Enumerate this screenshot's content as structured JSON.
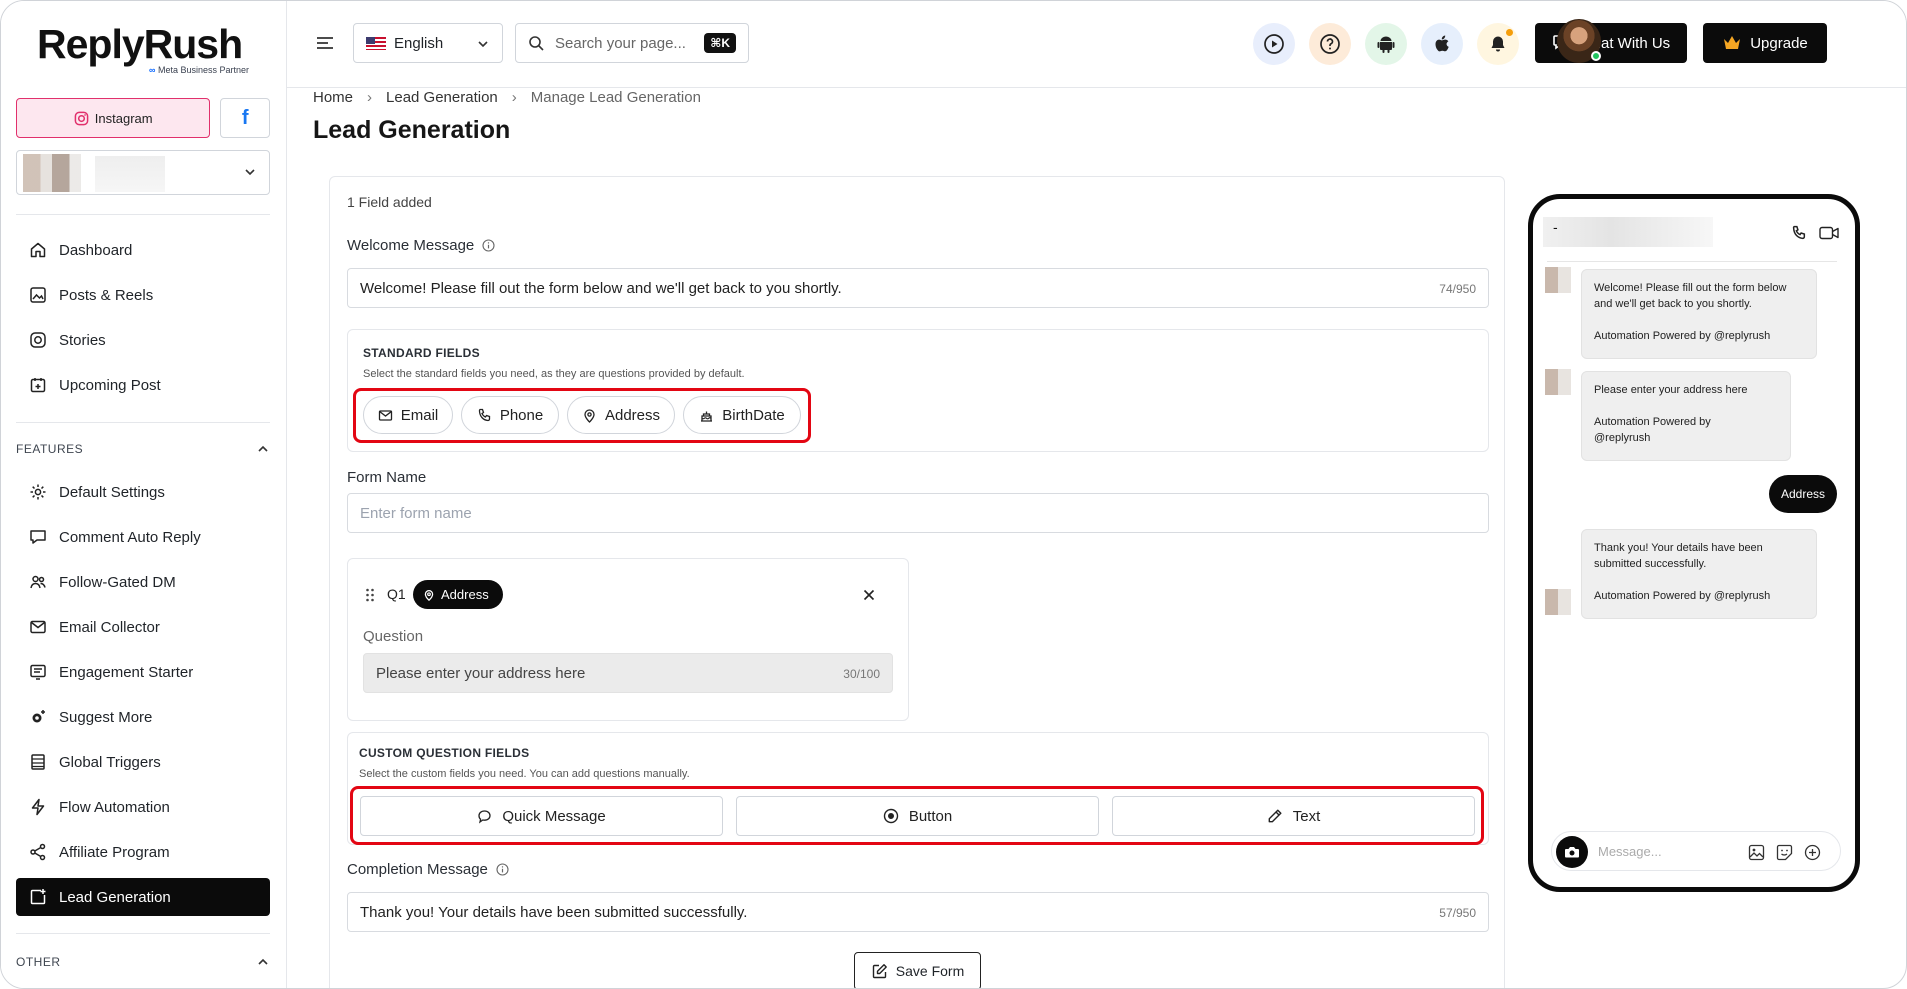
{
  "brand": {
    "name": "ReplyRush",
    "tagline": "Meta Business Partner"
  },
  "platforms": {
    "instagram": "Instagram",
    "facebook": "f"
  },
  "nav": {
    "main": [
      "Dashboard",
      "Posts & Reels",
      "Stories",
      "Upcoming Post"
    ],
    "features_label": "FEATURES",
    "features": [
      "Default Settings",
      "Comment Auto Reply",
      "Follow-Gated DM",
      "Email Collector",
      "Engagement Starter",
      "Suggest More",
      "Global Triggers",
      "Flow Automation",
      "Affiliate Program",
      "Lead Generation"
    ],
    "active": "Lead Generation",
    "other_label": "OTHER"
  },
  "header": {
    "language": "English",
    "search_placeholder": "Search your page...",
    "shortcut": "⌘K",
    "chat_button": "Chat With Us",
    "upgrade_button": "Upgrade",
    "icon_colors": {
      "play": "#e8eefc",
      "help": "#fdebd9",
      "android": "#e3f6e8",
      "apple": "#e6effc",
      "bell": "#fff6e0"
    }
  },
  "breadcrumb": [
    "Home",
    "Lead Generation",
    "Manage Lead Generation"
  ],
  "page_title": "Lead Generation",
  "form": {
    "fields_added": "1 Field added",
    "welcome_label": "Welcome Message",
    "welcome_value": "Welcome! Please fill out the form below and we'll get back to you shortly.",
    "welcome_count": "74/950",
    "standard_title": "STANDARD FIELDS",
    "standard_desc": "Select the standard fields you need, as they are questions provided by default.",
    "standard_fields": [
      "Email",
      "Phone",
      "Address",
      "BirthDate"
    ],
    "form_name_label": "Form Name",
    "form_name_placeholder": "Enter form name",
    "question": {
      "number": "Q1",
      "type": "Address",
      "label": "Question",
      "value": "Please enter your address here",
      "count": "30/100"
    },
    "custom_title": "CUSTOM QUESTION FIELDS",
    "custom_desc": "Select the custom fields you need. You can add questions manually.",
    "custom_fields": [
      "Quick Message",
      "Button",
      "Text"
    ],
    "completion_label": "Completion Message",
    "completion_value": "Thank you! Your details have been submitted successfully.",
    "completion_count": "57/950",
    "save_button": "Save Form"
  },
  "preview": {
    "dash": "-",
    "bubble1": [
      "Welcome! Please fill out the form below",
      "and we'll get back to you shortly.",
      "",
      "Automation Powered by @replyrush"
    ],
    "bubble2": [
      "Please enter your address here",
      "",
      "Automation Powered by",
      "@replyrush"
    ],
    "reply": "Address",
    "bubble3": [
      "Thank you! Your details have been",
      "submitted successfully.",
      "",
      "Automation Powered by @replyrush"
    ],
    "message_placeholder": "Message..."
  },
  "colors": {
    "accent": "#0b0b0b",
    "highlight": "#e30613",
    "instagram": "#e1306c",
    "facebook": "#1877f2"
  }
}
